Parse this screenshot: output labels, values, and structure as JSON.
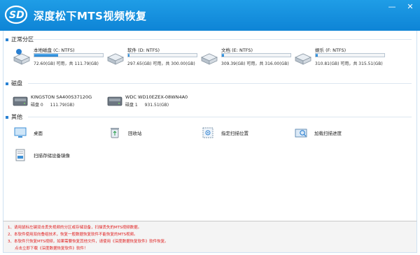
{
  "app": {
    "title": "深度松下MTS视频恢复",
    "logo_text": "SD"
  },
  "window_controls": {
    "minimize": "—",
    "close": "✕"
  },
  "sections": {
    "partitions": "正常分区",
    "disks": "磁盘",
    "others": "其他"
  },
  "partitions": [
    {
      "name": "本地磁盘 (C: NTFS)",
      "size": "72.60(GB) 可用，共 111.79(GB)",
      "used": 0.35
    },
    {
      "name": "软件 (D: NTFS)",
      "size": "297.65(GB) 可用，共 300.00(GB)",
      "used": 0.02
    },
    {
      "name": "文档 (E: NTFS)",
      "size": "309.39(GB) 可用，共 316.00(GB)",
      "used": 0.03
    },
    {
      "name": "娱乐 (F: NTFS)",
      "size": "310.81(GB) 可用，共 315.51(GB)",
      "used": 0.03
    }
  ],
  "disks": [
    {
      "model": "KINGSTON SA400S37120G",
      "label": "磁盘 0",
      "size": "111.79(GB)"
    },
    {
      "model": "WDC WD10EZEX-08WN4A0",
      "label": "磁盘 1",
      "size": "931.51(GB)"
    }
  ],
  "others": [
    {
      "label": "桌面"
    },
    {
      "label": "回收站"
    },
    {
      "label": "指定扫描位置"
    },
    {
      "label": "加载扫描进度"
    },
    {
      "label": "扫描存储设备镜像"
    }
  ],
  "notes": [
    "1、请用鼠标左键双击丢失视频的分区或存储设备，扫描丢失的MTS视频数据。",
    "2、本软件使用双向叠组技术，恢复一般数据恢复软件不能恢复的MTS视频。",
    "3、本软件只恢复MTS视频，如果需要恢复其他文件，请使用《深度数据恢复软件》软件恢复。",
    "点击立即下载《深度数据恢复软件》软件！"
  ],
  "colors": {
    "accent": "#1a8fe0",
    "notes_text": "#e02020"
  }
}
